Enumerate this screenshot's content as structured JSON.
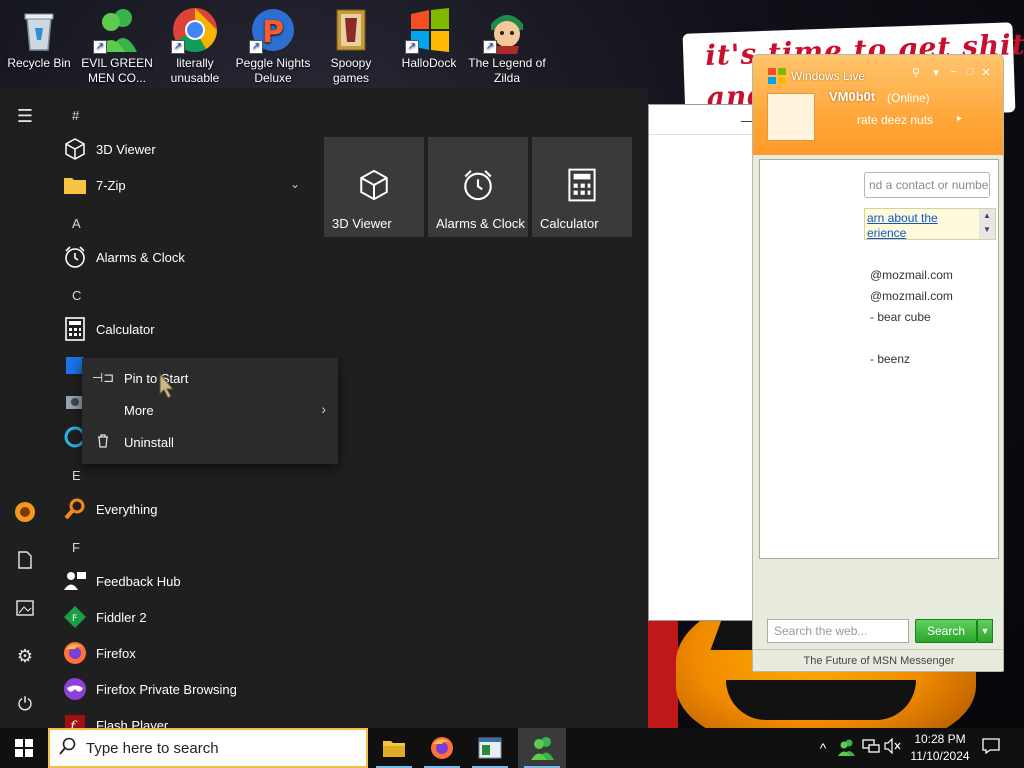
{
  "desktop": {
    "icons": [
      {
        "label": "Recycle Bin",
        "icon": "recycle-bin-icon"
      },
      {
        "label": "EVIL GREEN MEN CO...",
        "icon": "msn-buddies-icon"
      },
      {
        "label": "literally unusable",
        "icon": "chrome-icon"
      },
      {
        "label": "Peggle Nights Deluxe",
        "icon": "peggle-icon"
      },
      {
        "label": "Spoopy games",
        "icon": "folder-icon"
      },
      {
        "label": "HalloDock",
        "icon": "windows-logo-icon"
      },
      {
        "label": "The Legend of Zilda",
        "icon": "zilda-icon"
      }
    ],
    "wallpaper_text": [
      "it's time to get shit",
      "and"
    ]
  },
  "start_menu": {
    "rail": [
      "hamburger-menu-icon",
      "user-avatar-icon",
      "documents-icon",
      "pictures-icon",
      "settings-icon",
      "power-icon"
    ],
    "headers": {
      "hash": "#",
      "a": "A",
      "c": "C",
      "e": "E",
      "f": "F"
    },
    "apps": {
      "viewer3d": "3D Viewer",
      "zip": "7-Zip",
      "alarms": "Alarms & Clock",
      "calculator": "Calculator",
      "everything": "Everything",
      "feedback": "Feedback Hub",
      "fiddler": "Fiddler 2",
      "firefox": "Firefox",
      "firefox_private": "Firefox Private Browsing",
      "flash": "Flash Player"
    },
    "tiles": [
      {
        "label": "3D Viewer",
        "icon": "cube-icon"
      },
      {
        "label": "Alarms & Clock",
        "icon": "alarm-clock-icon"
      },
      {
        "label": "Calculator",
        "icon": "calculator-icon"
      }
    ]
  },
  "context_menu": {
    "pin": "Pin to Start",
    "more": "More",
    "uninstall": "Uninstall"
  },
  "messenger": {
    "title": "Windows Live",
    "username": "VM0b0t",
    "status": "(Online)",
    "personal_message": "rate deez nuts",
    "search_contacts_placeholder": "nd a contact or numbe",
    "info_line1": "arn about the",
    "info_line2": "erience",
    "contacts": [
      "@mozmail.com",
      "@mozmail.com",
      "- bear cube",
      "- beenz"
    ],
    "search_web_placeholder": "Search the web...",
    "search_button": "Search",
    "footer": "The Future of MSN Messenger"
  },
  "taskbar": {
    "search_placeholder": "Type here to search",
    "apps": [
      "file-explorer-icon",
      "firefox-icon",
      "terminal-window-icon",
      "msn-messenger-icon"
    ],
    "time": "10:28 PM",
    "date": "11/10/2024"
  },
  "colors": {
    "start_bg": "#1f1f1f",
    "tile_bg": "#3a3a3a",
    "messenger_orange": "#ffa83c",
    "search_green": "#2aa52a",
    "taskbar_search_border": "#f0c04a"
  }
}
